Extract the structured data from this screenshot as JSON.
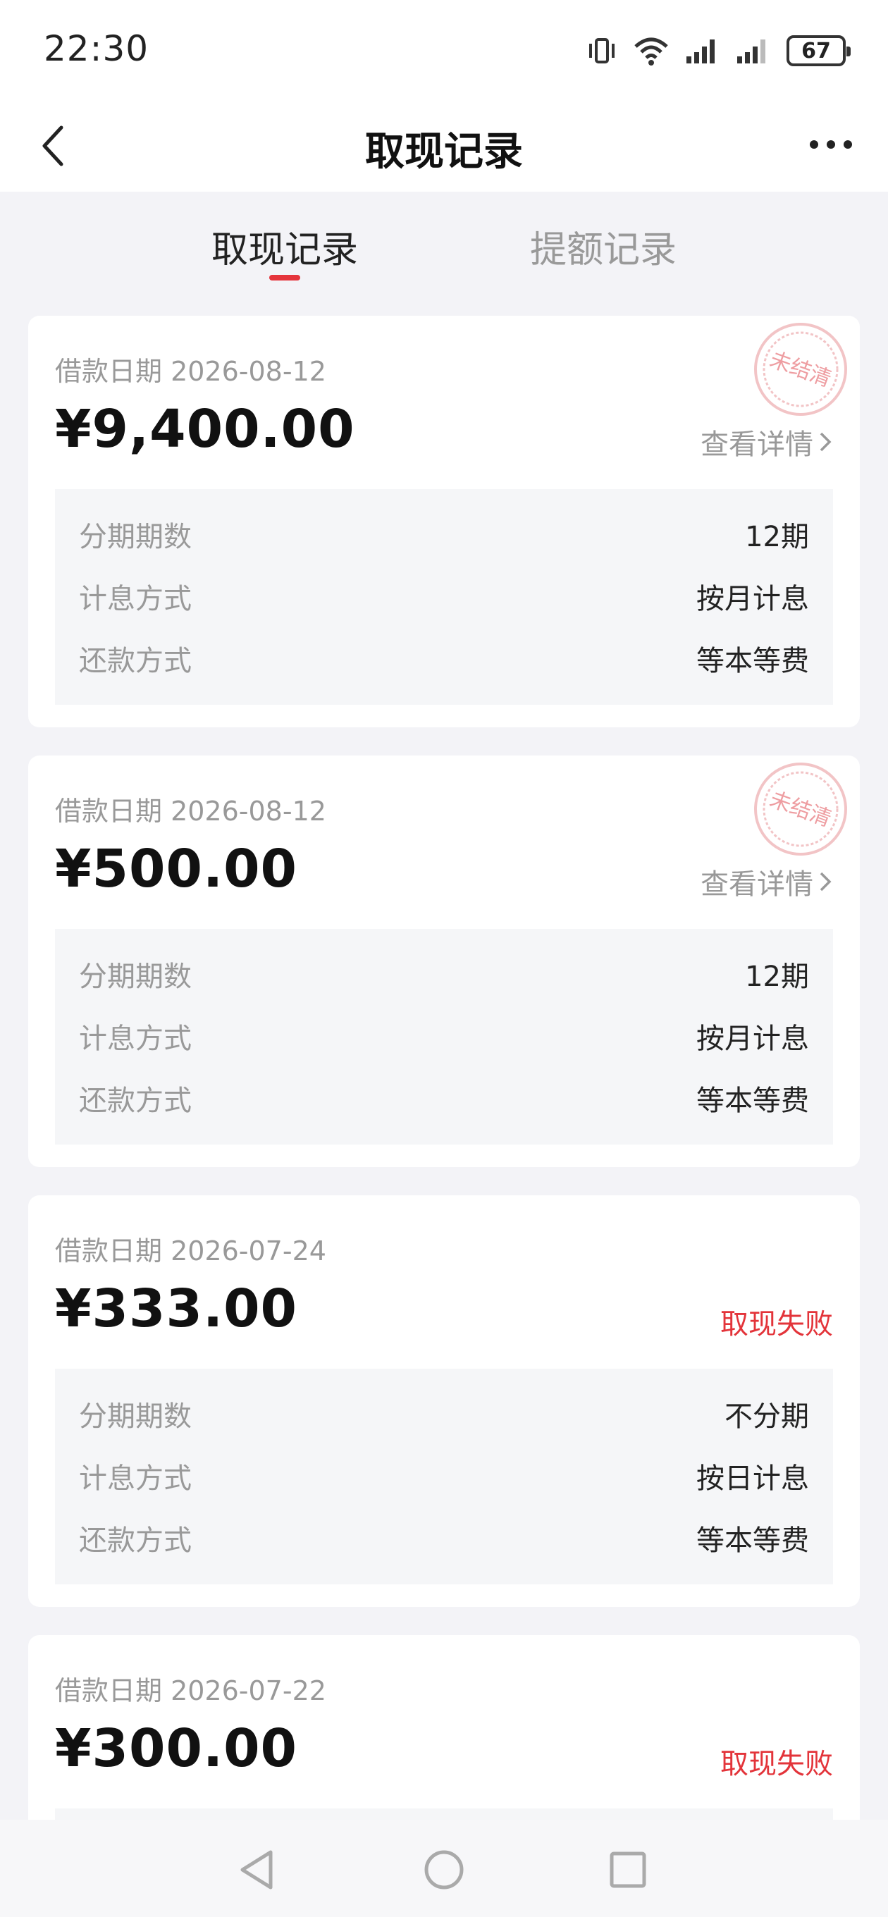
{
  "status_bar": {
    "time": "22:30",
    "battery": "67",
    "icons": [
      "vibrate-icon",
      "wifi-icon",
      "signal-icon",
      "signal-icon"
    ]
  },
  "header": {
    "title": "取现记录",
    "back_icon": "chevron-left-icon",
    "more_icon": "more-horizontal-icon"
  },
  "tabs": [
    {
      "label": "取现记录",
      "active": true
    },
    {
      "label": "提额记录",
      "active": false
    }
  ],
  "records": [
    {
      "date_label": "借款日期 2026-08-12",
      "amount": "¥9,400.00",
      "action": "查看详情",
      "stamp": "未结清",
      "rows": [
        {
          "label": "分期期数",
          "value": "12期"
        },
        {
          "label": "计息方式",
          "value": "按月计息"
        },
        {
          "label": "还款方式",
          "value": "等本等费"
        }
      ]
    },
    {
      "date_label": "借款日期 2026-08-12",
      "amount": "¥500.00",
      "action": "查看详情",
      "stamp": "未结清",
      "rows": [
        {
          "label": "分期期数",
          "value": "12期"
        },
        {
          "label": "计息方式",
          "value": "按月计息"
        },
        {
          "label": "还款方式",
          "value": "等本等费"
        }
      ]
    },
    {
      "date_label": "借款日期 2026-07-24",
      "amount": "¥333.00",
      "status": "取现失败",
      "rows": [
        {
          "label": "分期期数",
          "value": "不分期"
        },
        {
          "label": "计息方式",
          "value": "按日计息"
        },
        {
          "label": "还款方式",
          "value": "等本等费"
        }
      ]
    },
    {
      "date_label": "借款日期 2026-07-22",
      "amount": "¥300.00",
      "status": "取现失败"
    }
  ],
  "colors": {
    "accent": "#e5353c",
    "fail": "#e3343a",
    "background": "#f3f3f7"
  }
}
